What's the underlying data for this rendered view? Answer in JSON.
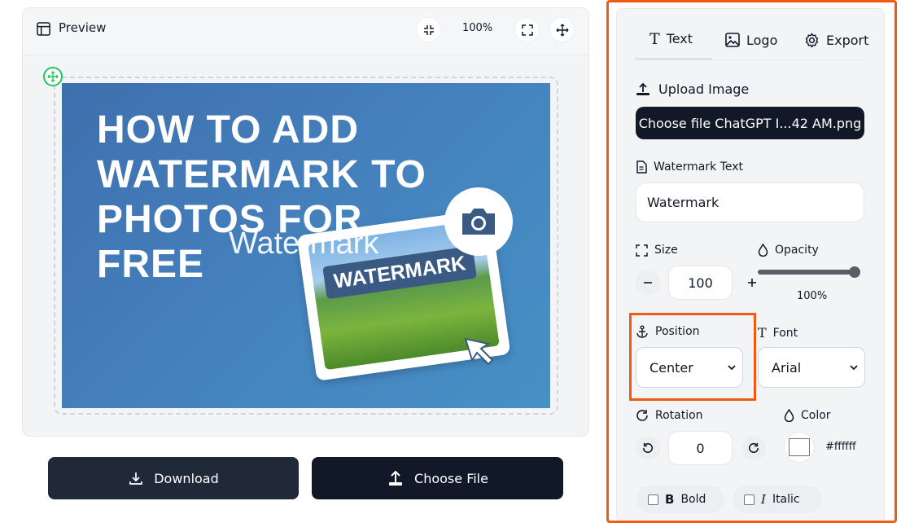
{
  "preview": {
    "title": "Preview",
    "zoom": "100%"
  },
  "image": {
    "headline": "HOW TO ADD WATERMARK TO PHOTOS FOR FREE",
    "overlay_watermark": "Watermark",
    "banner_text": "WATERMARK"
  },
  "actions": {
    "download_label": "Download",
    "choose_file_label": "Choose File"
  },
  "panel": {
    "tabs": [
      {
        "label": "Text",
        "icon": "text-icon"
      },
      {
        "label": "Logo",
        "icon": "image-icon"
      },
      {
        "label": "Export",
        "icon": "gear-icon"
      }
    ],
    "active_tab": "Text",
    "upload_label": "Upload Image",
    "file_button": "Choose file ChatGPT I...42 AM.png",
    "watermark_text_label": "Watermark Text",
    "watermark_text_value": "Watermark",
    "size_label": "Size",
    "size_value": "100",
    "opacity_label": "Opacity",
    "opacity_value": "100%",
    "opacity_fraction": 1.0,
    "position_label": "Position",
    "position_value": "Center",
    "font_label": "Font",
    "font_value": "Arial",
    "rotation_label": "Rotation",
    "rotation_value": "0",
    "color_label": "Color",
    "color_value": "#ffffff",
    "bold_label": "Bold",
    "italic_label": "Italic"
  },
  "colors": {
    "accent_highlight": "#f05a13",
    "dark_button": "#111827",
    "move_handle": "#22c55e"
  }
}
